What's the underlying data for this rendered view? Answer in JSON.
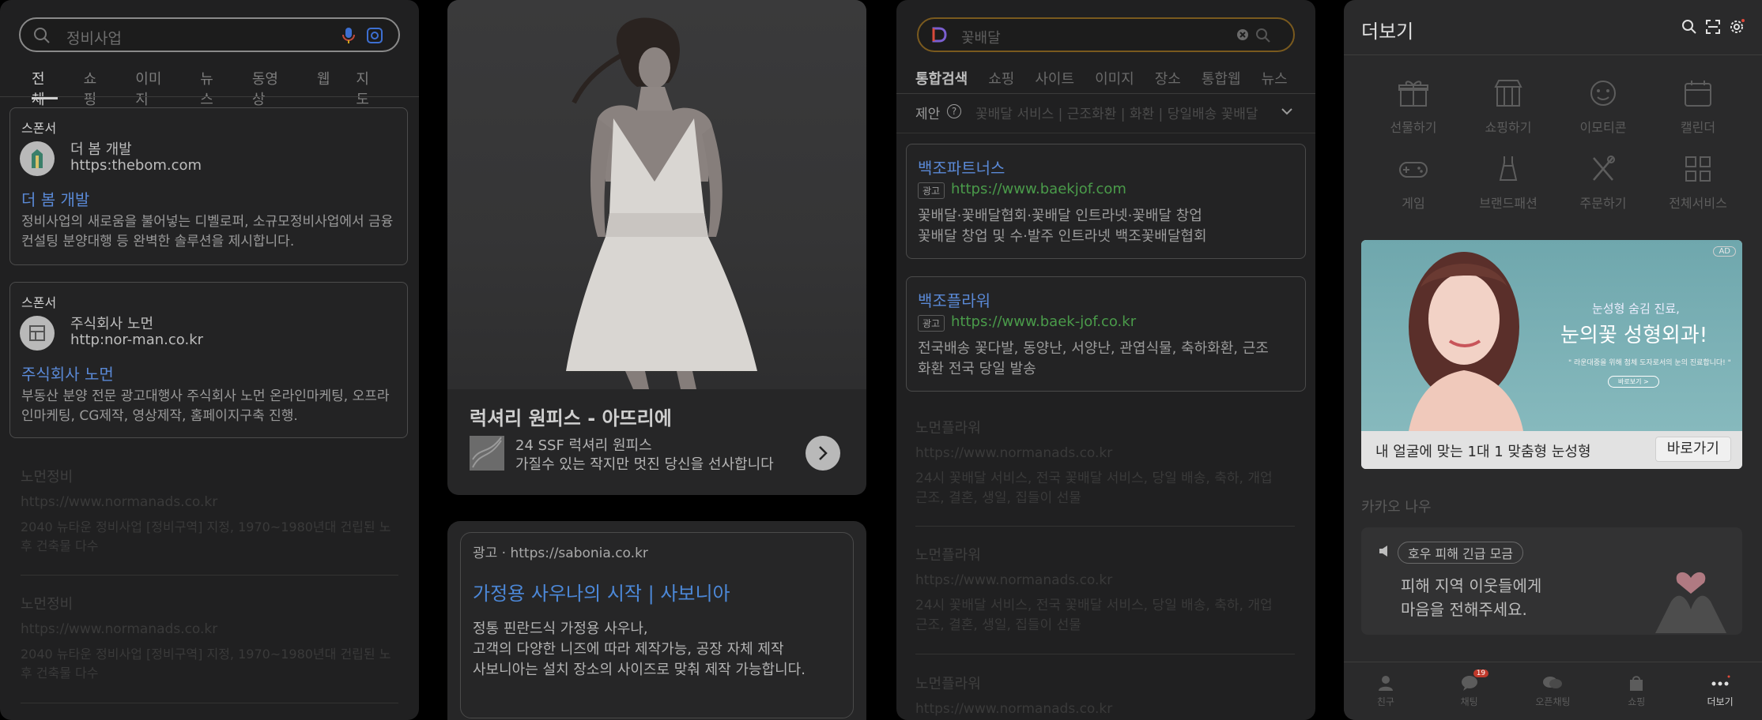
{
  "panel1": {
    "search": {
      "query": "정비사업"
    },
    "tabs": [
      "전체",
      "쇼핑",
      "이미지",
      "뉴스",
      "동영상",
      "웹",
      "지도"
    ],
    "ads": [
      {
        "sponsor": "스폰서",
        "name": "더 봄 개발",
        "url": "https:thebom.com",
        "title": "더 봄 개발",
        "desc": "정비사업의 새로움을 불어넣는 디벨로퍼, 소규모정비사업에서 금융컨설팅 분양대행 등 완벽한 솔루션을 제시합니다."
      },
      {
        "sponsor": "스폰서",
        "name": "주식회사 노먼",
        "url": "http:nor-man.co.kr",
        "title": "주식회사 노먼",
        "desc": "부동산 분양 전문 광고대행사 주식회사 노먼 온라인마케팅, 오프라인마케팅, CG제작, 영상제작, 홈페이지구축 진행."
      }
    ],
    "results": [
      {
        "title": "노먼정비",
        "url": "https://www.normanads.co.kr",
        "desc": "2040 뉴타운 정비사업 [정비구역] 지정, 1970~1980년대 건립된 노후 건축물 다수"
      },
      {
        "title": "노먼정비",
        "url": "https://www.normanads.co.kr",
        "desc": "2040 뉴타운 정비사업 [정비구역] 지정, 1970~1980년대 건립된 노후 건축물 다수"
      }
    ]
  },
  "panel2": {
    "title": "럭셔리 원피스 - 아뜨리에",
    "sub1": "24 SSF 럭셔리 원피스",
    "sub2": "가질수 있는 작지만 멋진 당신을 선사합니다",
    "ad_label": "광고 · https://sabonia.co.kr",
    "ad_title": "가정용 사우나의 시작 | 사보니아",
    "ad_desc1": "정통 핀란드식 가정용 사우나,",
    "ad_desc2": "고객의 다양한 니즈에 따라 제작가능, 공장 자체 제작",
    "ad_desc3": "사보니아는 설치 장소의 사이즈로 맞춰 제작 가능합니다."
  },
  "panel3": {
    "search": {
      "query": "꽃배달"
    },
    "tabs": [
      "통합검색",
      "쇼핑",
      "사이트",
      "이미지",
      "장소",
      "통합웹",
      "뉴스"
    ],
    "suggest_label": "제안",
    "suggest_items": "꽃배달 서비스 | 근조화환 | 화환 | 당일배송 꽃배달",
    "ads": [
      {
        "title": "백조파트너스",
        "badge": "광고",
        "url": "https://www.baekjof.com",
        "desc1": "꽃배달·꽃배달협회·꽃배달 인트라넷·꽃배달 창업",
        "desc2": "꽃배달 창업 및 수·발주 인트라넷 백조꽃배달협회"
      },
      {
        "title": "백조플라워",
        "badge": "광고",
        "url": "https://www.baek-jof.co.kr",
        "desc1": "전국배송 꽃다발, 동양난, 서양난, 관엽식물, 축하화환, 근조",
        "desc2": "화환 전국 당일 발송"
      }
    ],
    "results": [
      {
        "title": "노먼플라워",
        "url": "https://www.normanads.co.kr",
        "desc1": "24시 꽃배달 서비스, 전국 꽃배달 서비스, 당일 배송, 축하, 개업",
        "desc2": "근조, 결혼, 생일, 집들이 선물"
      },
      {
        "title": "노먼플라워",
        "url": "https://www.normanads.co.kr",
        "desc1": "24시 꽃배달 서비스, 전국 꽃배달 서비스, 당일 배송, 축하, 개업",
        "desc2": "근조, 결혼, 생일, 집들이 선물"
      },
      {
        "title": "노먼플라워",
        "url": "https://www.normanads.co.kr"
      }
    ]
  },
  "panel4": {
    "title": "더보기",
    "services": [
      "선물하기",
      "쇼핑하기",
      "이모티콘",
      "캘린더",
      "게임",
      "브랜드패션",
      "주문하기",
      "전체서비스"
    ],
    "banner": {
      "ad": "AD",
      "line1": "눈성형 숨김 진료,",
      "line2": "눈의꽃 성형외과!",
      "line3": "\" 라운대중을 위해 첨체 도자로서의 눈의 진료합니다! \"",
      "button_small": "바로보기 >",
      "caption": "내 얼굴에 맞는 1대 1 맞춤형 눈성형",
      "go": "바로가기"
    },
    "now_label": "카카오 나우",
    "now_tag": "호우 피해 긴급 모금",
    "now_msg1": "피해 지역 이웃들에게",
    "now_msg2": "마음을 전해주세요.",
    "nav": [
      "친구",
      "채팅",
      "오픈채팅",
      "쇼핑",
      "더보기"
    ],
    "chat_badge": "19"
  }
}
